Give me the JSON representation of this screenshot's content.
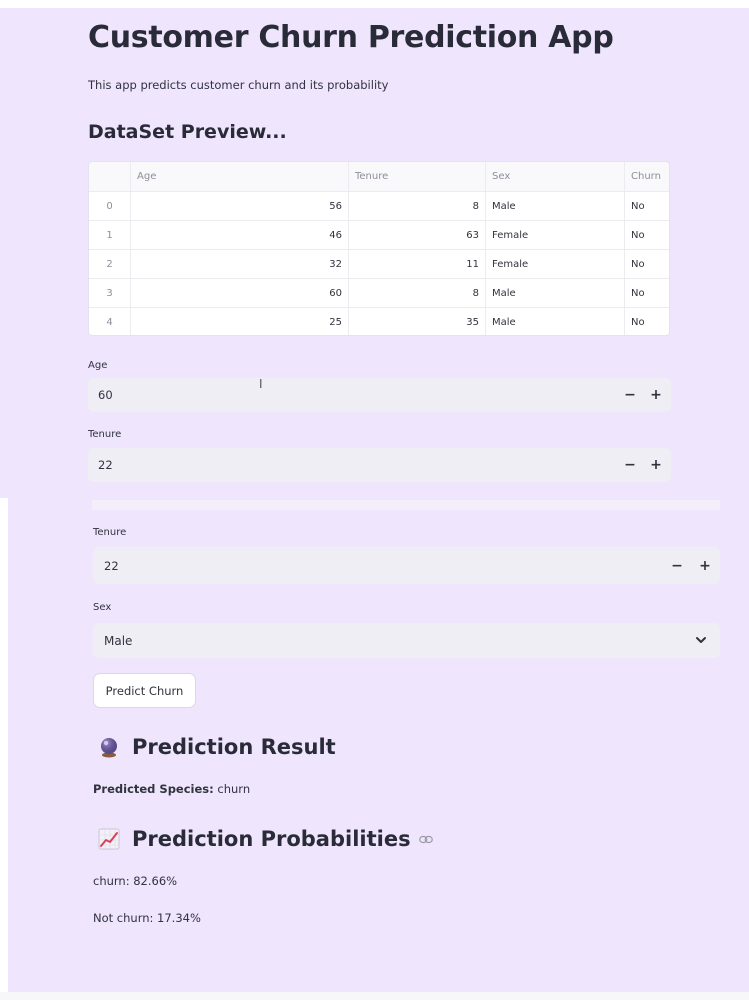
{
  "app": {
    "title": "Customer Churn Prediction App",
    "subtitle": "This app predicts customer churn and its probability"
  },
  "dataset": {
    "heading": "DataSet Preview...",
    "columns": [
      "",
      "Age",
      "Tenure",
      "Sex",
      "Churn"
    ],
    "rows": [
      [
        "0",
        "56",
        "8",
        "Male",
        "No"
      ],
      [
        "1",
        "46",
        "63",
        "Female",
        "No"
      ],
      [
        "2",
        "32",
        "11",
        "Female",
        "No"
      ],
      [
        "3",
        "60",
        "8",
        "Male",
        "No"
      ],
      [
        "4",
        "25",
        "35",
        "Male",
        "No"
      ]
    ]
  },
  "form": {
    "age": {
      "label": "Age",
      "value": "60",
      "minus": "−",
      "plus": "+"
    },
    "tenure_top": {
      "label": "Tenure",
      "value": "22",
      "minus": "−",
      "plus": "+"
    },
    "tenure": {
      "label": "Tenure",
      "value": "22",
      "minus": "−",
      "plus": "+"
    },
    "sex": {
      "label": "Sex",
      "value": "Male",
      "icon": "chevron-down-icon"
    },
    "predict_button": "Predict Churn"
  },
  "result": {
    "heading": "Prediction Result",
    "heading_icon": "crystal-ball-icon",
    "predicted_label": "Predicted Species:",
    "predicted_value": "churn"
  },
  "probabilities": {
    "heading": "Prediction Probabilities",
    "heading_icon": "chart-increasing-icon",
    "link_icon": "link-icon",
    "churn": "churn: 82.66%",
    "not_churn": "Not churn: 17.34%"
  },
  "colors": {
    "background": "#efe5fc",
    "input_background": "#f0eef5",
    "text": "#31333f"
  }
}
